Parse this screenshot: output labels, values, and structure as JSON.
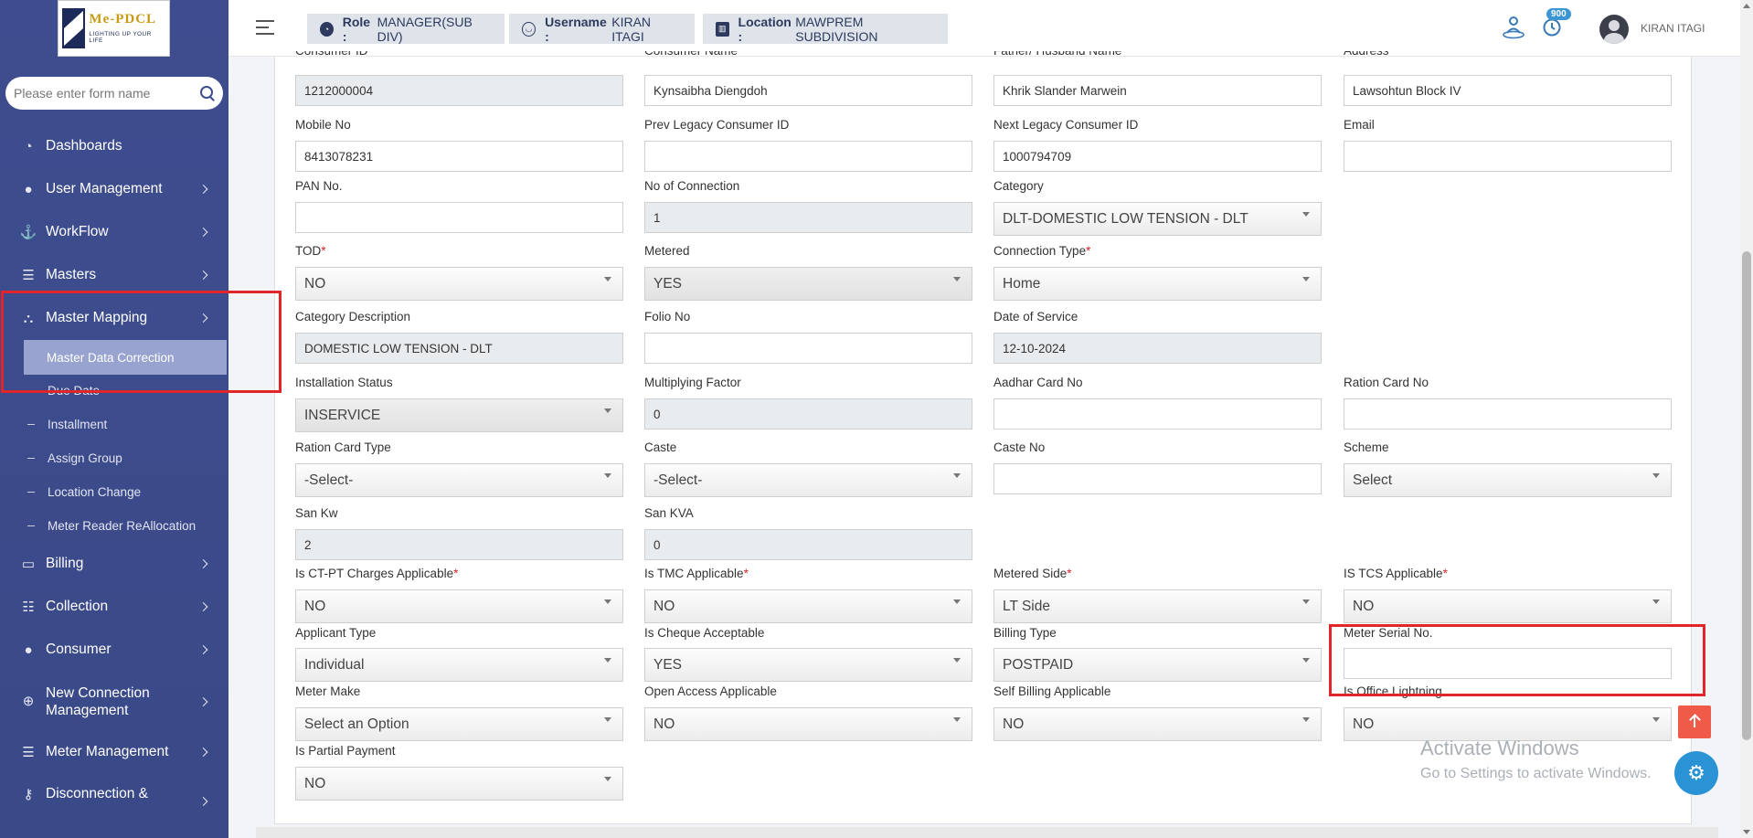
{
  "logo": {
    "title": "Me-PDCL",
    "tagline": "LIGHTING UP YOUR LIFE"
  },
  "sidebar": {
    "search_placeholder": "Please enter form name",
    "items": [
      {
        "label": "Dashboards",
        "icon": "gauge-icon"
      },
      {
        "label": "User Management",
        "icon": "user-icon"
      },
      {
        "label": "WorkFlow",
        "icon": "anchor-icon"
      },
      {
        "label": "Masters",
        "icon": "list-icon"
      },
      {
        "label": "Master Mapping",
        "icon": "sitemap-icon"
      },
      {
        "label": "Billing",
        "icon": "monitor-icon"
      },
      {
        "label": "Collection",
        "icon": "list-ul-icon"
      },
      {
        "label": "Consumer",
        "icon": "user-icon"
      },
      {
        "label": "New Connection Management",
        "icon": "plus-circle-icon"
      },
      {
        "label": "Meter Management",
        "icon": "list-icon"
      },
      {
        "label": "Disconnection &",
        "icon": "key-icon"
      }
    ],
    "sub_items": [
      {
        "label": "Master Data Correction"
      },
      {
        "label": "Due Date"
      },
      {
        "label": "Installment"
      },
      {
        "label": "Assign Group"
      },
      {
        "label": "Location Change"
      },
      {
        "label": "Meter Reader ReAllocation"
      }
    ]
  },
  "header": {
    "role_label": "Role :",
    "role_value": "MANAGER(SUB DIV)",
    "username_label": "Username :",
    "username_value": "KIRAN ITAGI",
    "location_label": "Location :",
    "location_value": "MAWPREM SUBDIVISION",
    "notification_count": "900",
    "user_name": "KIRAN ITAGI"
  },
  "form": {
    "top_cut_labels": [
      "Consumer ID",
      "Consumer Name",
      "Father/ Husband Name",
      "Address"
    ],
    "fields": [
      {
        "label": "",
        "value": "1212000004",
        "readonly": true
      },
      {
        "label": "",
        "value": "Kynsaibha Diengdoh"
      },
      {
        "label": "",
        "value": "Khrik Slander Marwein"
      },
      {
        "label": "",
        "value": "Lawsohtun Block IV"
      },
      {
        "label": "Mobile No",
        "value": "8413078231"
      },
      {
        "label": "Prev Legacy Consumer ID",
        "value": ""
      },
      {
        "label": "Next Legacy Consumer ID",
        "value": "1000794709"
      },
      {
        "label": "Email",
        "value": ""
      },
      {
        "label": "PAN No.",
        "value": ""
      },
      {
        "label": "No of Connection",
        "value": "1",
        "readonly": true
      },
      {
        "label": "Category",
        "value": "DLT-DOMESTIC LOW TENSION - DLT",
        "select": true
      },
      {
        "label": "TOD",
        "required": true,
        "value": "NO",
        "select": true
      },
      {
        "label": "Metered",
        "value": "YES",
        "select": true,
        "readonly": true
      },
      {
        "label": "Connection Type",
        "required": true,
        "value": "Home",
        "select": true
      },
      {
        "label": "Category Description",
        "value": "DOMESTIC LOW TENSION - DLT",
        "readonly": true
      },
      {
        "label": "Folio No",
        "value": ""
      },
      {
        "label": "Date of Service",
        "value": "12-10-2024",
        "readonly": true
      },
      {
        "label": "Installation Status",
        "value": "INSERVICE",
        "select": true,
        "readonly": true
      },
      {
        "label": "Multiplying Factor",
        "value": "0",
        "readonly": true
      },
      {
        "label": "Aadhar Card No",
        "value": ""
      },
      {
        "label": "Ration Card No",
        "value": ""
      },
      {
        "label": "Ration Card Type",
        "value": "-Select-",
        "select": true
      },
      {
        "label": "Caste",
        "value": "-Select-",
        "select": true
      },
      {
        "label": "Caste No",
        "value": ""
      },
      {
        "label": "Scheme",
        "value": "Select",
        "select": true
      },
      {
        "label": "San Kw",
        "value": "2",
        "readonly": true
      },
      {
        "label": "San KVA",
        "value": "0",
        "readonly": true
      },
      {
        "label": "Is CT-PT Charges Applicable",
        "required": true,
        "value": "NO",
        "select": true
      },
      {
        "label": "Is TMC Applicable",
        "required": true,
        "value": "NO",
        "select": true
      },
      {
        "label": "Metered Side",
        "required": true,
        "value": "LT Side",
        "select": true
      },
      {
        "label": "IS TCS Applicable",
        "required": true,
        "value": "NO",
        "select": true
      },
      {
        "label": "Applicant Type",
        "value": "Individual",
        "select": true
      },
      {
        "label": "Is Cheque Acceptable",
        "value": "YES",
        "select": true
      },
      {
        "label": "Billing Type",
        "value": "POSTPAID",
        "select": true
      },
      {
        "label": "Meter Serial No.",
        "value": ""
      },
      {
        "label": "Meter Make",
        "value": "Select an Option",
        "select": true
      },
      {
        "label": "Open Access Applicable",
        "value": "NO",
        "select": true
      },
      {
        "label": "Self Billing Applicable",
        "value": "NO",
        "select": true
      },
      {
        "label": "Is Office Lightning",
        "value": "NO",
        "select": true
      },
      {
        "label": "Is Partial Payment",
        "value": "NO",
        "select": true
      }
    ]
  },
  "watermark": {
    "line1": "Activate Windows",
    "line2": "Go to Settings to activate Windows."
  },
  "colors": {
    "sidebar": "#3e4d8f",
    "highlight": "#e0262b",
    "accent": "#2a93d5",
    "top_button": "#ef5a49"
  }
}
